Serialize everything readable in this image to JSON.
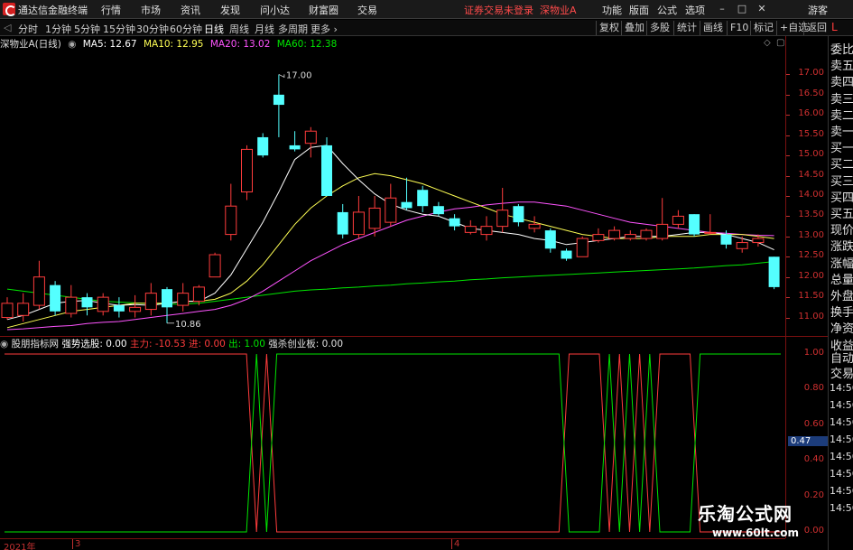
{
  "app": {
    "title": "通达信金融终端",
    "menu": [
      "行情",
      "市场",
      "资讯",
      "发现",
      "问小达",
      "财富圈",
      "交易"
    ],
    "trade_status": "证券交易未登录",
    "stock_name_top": "深物业A",
    "right_menu": [
      "功能",
      "版面",
      "公式",
      "选项",
      "游客"
    ]
  },
  "toolbar": {
    "periods": [
      "分时",
      "1分钟",
      "5分钟",
      "15分钟",
      "30分钟",
      "60分钟",
      "日线",
      "周线",
      "月线",
      "多周期",
      "更多"
    ],
    "active_period": "日线",
    "right_buttons": [
      "复权",
      "叠加",
      "多股",
      "统计",
      "画线",
      "F10",
      "标记",
      "+自选",
      "返回"
    ]
  },
  "main_info": {
    "title": "深物业A(日线)",
    "ma5": "MA5: 12.67",
    "ma10": "MA10: 12.95",
    "ma20": "MA20: 13.02",
    "ma60": "MA60: 12.38"
  },
  "price_axis": [
    "17.00",
    "16.50",
    "16.00",
    "15.50",
    "15.00",
    "14.50",
    "14.00",
    "13.50",
    "13.00",
    "12.50",
    "12.00",
    "11.50",
    "11.00"
  ],
  "price_annotations": {
    "high": "17.00",
    "low": "10.86"
  },
  "indicator": {
    "name": "股朋指标网",
    "strong_pick": "强势选股: 0.00",
    "main_force": "主力: -10.53",
    "in": "进: 0.00",
    "out": "出: 1.00",
    "strong_kill": "强杀创业板: 0.00",
    "axis": [
      "1.00",
      "0.80",
      "0.60",
      "0.40",
      "0.20",
      "0.00"
    ]
  },
  "dates": {
    "year": "2021年",
    "m3": "3",
    "m4": "4"
  },
  "right_panel": {
    "top_label": "L",
    "items": [
      "委比",
      "卖五",
      "卖四",
      "卖三",
      "卖二",
      "卖一",
      "买一",
      "买二",
      "买三",
      "买四",
      "买五",
      "现价",
      "涨跌",
      "涨幅",
      "总量",
      "外盘",
      "换手",
      "净资",
      "收益"
    ],
    "lower_items": [
      "自动",
      "交易"
    ],
    "times": [
      "14:56",
      "14:56",
      "14:56",
      "14:56",
      "14:56",
      "14:56",
      "14:56",
      "14:56"
    ],
    "value_tag": "0.47"
  },
  "watermark": {
    "title": "乐淘公式网",
    "url": "www.60lt.com"
  },
  "colors": {
    "up": "#ff3c3c",
    "down": "#54ffff",
    "ma5": "#ffffff",
    "ma10": "#ffff54",
    "ma20": "#ff54ff",
    "ma60": "#00e600",
    "axis_red": "#c03030"
  },
  "chart_data": {
    "type": "candlestick",
    "ylim": [
      10.7,
      17.5
    ],
    "candles": [
      {
        "o": 11.0,
        "c": 11.35,
        "h": 11.5,
        "l": 10.95
      },
      {
        "o": 11.05,
        "c": 11.35,
        "h": 11.6,
        "l": 10.9
      },
      {
        "o": 11.3,
        "c": 12.0,
        "h": 12.4,
        "l": 11.2
      },
      {
        "o": 11.8,
        "c": 11.15,
        "h": 11.9,
        "l": 11.05
      },
      {
        "o": 11.1,
        "c": 11.5,
        "h": 11.8,
        "l": 11.0
      },
      {
        "o": 11.5,
        "c": 11.25,
        "h": 11.6,
        "l": 11.05
      },
      {
        "o": 11.15,
        "c": 11.5,
        "h": 11.6,
        "l": 11.05
      },
      {
        "o": 11.3,
        "c": 11.15,
        "h": 11.5,
        "l": 11.0
      },
      {
        "o": 11.15,
        "c": 11.25,
        "h": 11.55,
        "l": 11.0
      },
      {
        "o": 11.2,
        "c": 11.6,
        "h": 11.85,
        "l": 11.05
      },
      {
        "o": 11.7,
        "c": 11.25,
        "h": 11.75,
        "l": 10.86
      },
      {
        "o": 11.3,
        "c": 11.6,
        "h": 11.85,
        "l": 11.15
      },
      {
        "o": 11.4,
        "c": 11.75,
        "h": 11.8,
        "l": 11.3
      },
      {
        "o": 12.0,
        "c": 12.55,
        "h": 12.6,
        "l": 12.0
      },
      {
        "o": 13.05,
        "c": 13.75,
        "h": 14.3,
        "l": 12.9
      },
      {
        "o": 14.1,
        "c": 15.15,
        "h": 15.25,
        "l": 13.9
      },
      {
        "o": 15.45,
        "c": 15.0,
        "h": 15.55,
        "l": 14.95
      },
      {
        "o": 16.5,
        "c": 16.25,
        "h": 17.0,
        "l": 15.45
      },
      {
        "o": 15.25,
        "c": 15.15,
        "h": 15.6,
        "l": 15.1
      },
      {
        "o": 15.3,
        "c": 15.6,
        "h": 15.7,
        "l": 14.95
      },
      {
        "o": 15.25,
        "c": 14.0,
        "h": 15.45,
        "l": 14.0
      },
      {
        "o": 13.6,
        "c": 13.05,
        "h": 13.8,
        "l": 12.95
      },
      {
        "o": 13.05,
        "c": 13.6,
        "h": 14.0,
        "l": 12.95
      },
      {
        "o": 13.2,
        "c": 13.7,
        "h": 14.0,
        "l": 13.0
      },
      {
        "o": 13.35,
        "c": 13.95,
        "h": 14.3,
        "l": 13.25
      },
      {
        "o": 13.85,
        "c": 13.7,
        "h": 14.45,
        "l": 13.65
      },
      {
        "o": 14.15,
        "c": 13.75,
        "h": 14.25,
        "l": 13.6
      },
      {
        "o": 13.75,
        "c": 13.55,
        "h": 13.85,
        "l": 13.5
      },
      {
        "o": 13.45,
        "c": 13.25,
        "h": 13.55,
        "l": 13.15
      },
      {
        "o": 13.1,
        "c": 13.25,
        "h": 13.4,
        "l": 13.05
      },
      {
        "o": 13.05,
        "c": 13.25,
        "h": 13.5,
        "l": 12.9
      },
      {
        "o": 13.25,
        "c": 13.65,
        "h": 14.2,
        "l": 13.1
      },
      {
        "o": 13.75,
        "c": 13.35,
        "h": 13.8,
        "l": 13.25
      },
      {
        "o": 13.2,
        "c": 13.3,
        "h": 13.5,
        "l": 13.1
      },
      {
        "o": 13.15,
        "c": 12.7,
        "h": 13.2,
        "l": 12.6
      },
      {
        "o": 12.65,
        "c": 12.45,
        "h": 12.7,
        "l": 12.4
      },
      {
        "o": 12.5,
        "c": 12.95,
        "h": 13.0,
        "l": 12.5
      },
      {
        "o": 12.9,
        "c": 13.05,
        "h": 13.2,
        "l": 12.85
      },
      {
        "o": 12.95,
        "c": 13.15,
        "h": 13.25,
        "l": 12.9
      },
      {
        "o": 12.95,
        "c": 13.05,
        "h": 13.15,
        "l": 12.9
      },
      {
        "o": 12.95,
        "c": 13.15,
        "h": 13.2,
        "l": 12.9
      },
      {
        "o": 12.95,
        "c": 13.3,
        "h": 13.95,
        "l": 12.9
      },
      {
        "o": 13.3,
        "c": 13.5,
        "h": 13.65,
        "l": 13.2
      },
      {
        "o": 13.55,
        "c": 13.05,
        "h": 13.55,
        "l": 13.0
      },
      {
        "o": 13.1,
        "c": 13.1,
        "h": 13.55,
        "l": 13.05
      },
      {
        "o": 13.05,
        "c": 12.8,
        "h": 13.15,
        "l": 12.7
      },
      {
        "o": 12.7,
        "c": 12.85,
        "h": 13.0,
        "l": 12.6
      },
      {
        "o": 12.85,
        "c": 12.95,
        "h": 13.05,
        "l": 12.75
      },
      {
        "o": 12.5,
        "c": 11.75,
        "h": 12.5,
        "l": 11.7
      }
    ],
    "ma5": [
      10.95,
      11.05,
      11.2,
      11.35,
      11.4,
      11.42,
      11.35,
      11.3,
      11.32,
      11.3,
      11.35,
      11.4,
      11.4,
      11.6,
      12.05,
      12.7,
      13.35,
      14.1,
      14.9,
      15.2,
      15.25,
      14.8,
      14.4,
      14.05,
      13.8,
      13.65,
      13.55,
      13.5,
      13.35,
      13.2,
      13.15,
      13.1,
      13.05,
      12.95,
      12.9,
      12.8,
      12.85,
      12.9,
      12.95,
      13.0,
      13.0,
      13.0,
      13.05,
      13.1,
      13.1,
      13.05,
      12.95,
      12.85,
      12.67
    ],
    "ma10": [
      10.75,
      10.85,
      10.95,
      11.05,
      11.15,
      11.2,
      11.25,
      11.3,
      11.35,
      11.35,
      11.35,
      11.4,
      11.4,
      11.45,
      11.6,
      11.9,
      12.3,
      12.8,
      13.3,
      13.7,
      14.0,
      14.25,
      14.45,
      14.55,
      14.5,
      14.4,
      14.3,
      14.15,
      14.0,
      13.85,
      13.7,
      13.55,
      13.45,
      13.35,
      13.25,
      13.15,
      13.05,
      13.0,
      12.95,
      12.95,
      12.95,
      13.0,
      13.0,
      13.0,
      13.05,
      13.05,
      13.05,
      13.0,
      12.95
    ],
    "ma20": [
      10.7,
      10.72,
      10.75,
      10.78,
      10.8,
      10.85,
      10.88,
      10.9,
      10.95,
      11.0,
      11.05,
      11.1,
      11.15,
      11.2,
      11.3,
      11.45,
      11.65,
      11.9,
      12.15,
      12.4,
      12.6,
      12.8,
      12.95,
      13.1,
      13.25,
      13.4,
      13.5,
      13.6,
      13.68,
      13.72,
      13.78,
      13.82,
      13.85,
      13.85,
      13.8,
      13.75,
      13.65,
      13.55,
      13.45,
      13.35,
      13.3,
      13.25,
      13.2,
      13.15,
      13.1,
      13.08,
      13.05,
      13.03,
      13.02
    ],
    "ma60": [
      11.7,
      11.65,
      11.6,
      11.55,
      11.5,
      11.45,
      11.4,
      11.38,
      11.36,
      11.34,
      11.33,
      11.33,
      11.35,
      11.4,
      11.45,
      11.5,
      11.55,
      11.6,
      11.65,
      11.68,
      11.7,
      11.73,
      11.75,
      11.78,
      11.8,
      11.83,
      11.85,
      11.88,
      11.9,
      11.93,
      11.95,
      11.98,
      12.0,
      12.02,
      12.04,
      12.06,
      12.08,
      12.1,
      12.12,
      12.14,
      12.16,
      12.18,
      12.2,
      12.22,
      12.25,
      12.28,
      12.3,
      12.34,
      12.38
    ],
    "indicator": {
      "red": [
        1,
        1,
        1,
        1,
        1,
        1,
        1,
        1,
        1,
        1,
        1,
        1,
        1,
        1,
        1,
        1,
        1,
        1,
        1,
        1,
        1,
        1,
        1,
        1,
        1,
        0,
        1,
        0,
        0,
        0,
        0,
        0,
        0,
        0,
        0,
        0,
        0,
        0,
        0,
        0,
        0,
        0,
        0,
        0,
        0,
        0,
        0,
        0,
        0,
        0,
        0,
        0,
        0,
        0,
        0,
        0,
        1,
        1,
        1,
        1,
        0,
        1,
        0,
        1,
        0,
        1,
        1,
        1,
        1,
        0,
        0,
        0,
        0,
        0,
        0,
        0,
        0,
        0
      ],
      "green": [
        0,
        0,
        0,
        0,
        0,
        0,
        0,
        0,
        0,
        0,
        0,
        0,
        0,
        0,
        0,
        0,
        0,
        0,
        0,
        0,
        0,
        0,
        0,
        0,
        0,
        1,
        0,
        1,
        1,
        1,
        1,
        1,
        1,
        1,
        1,
        1,
        1,
        1,
        1,
        1,
        1,
        1,
        1,
        1,
        1,
        1,
        1,
        1,
        1,
        1,
        1,
        1,
        1,
        1,
        1,
        1,
        0,
        0,
        0,
        0,
        1,
        0,
        1,
        0,
        1,
        0,
        0,
        0,
        0,
        1,
        1,
        1,
        1,
        1,
        1,
        1,
        1,
        1
      ]
    }
  }
}
